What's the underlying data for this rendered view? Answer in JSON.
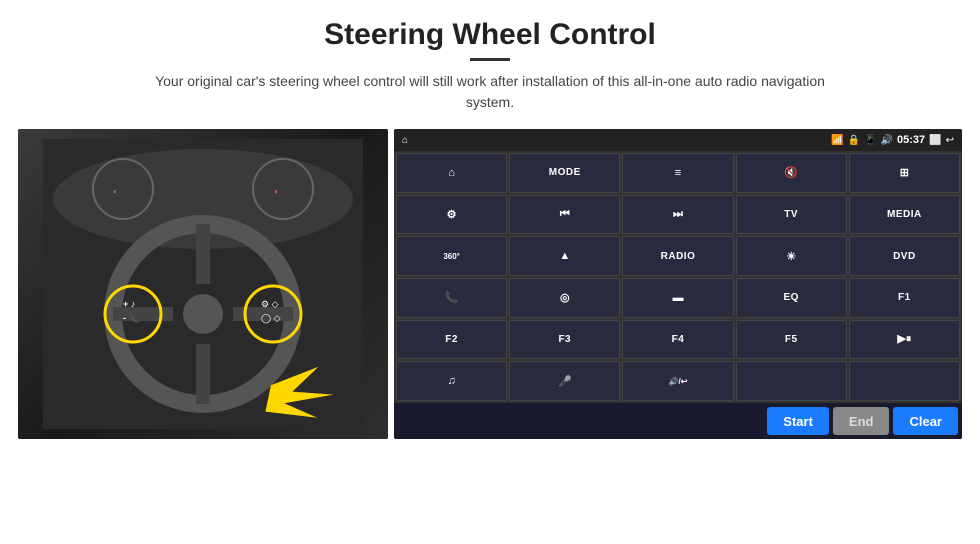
{
  "header": {
    "title": "Steering Wheel Control",
    "subtitle": "Your original car's steering wheel control will still work after installation of this all-in-one auto radio navigation system."
  },
  "status_bar": {
    "time": "05:37",
    "icons": [
      "wifi",
      "lock",
      "sim",
      "bluetooth",
      "back"
    ]
  },
  "grid_buttons": [
    {
      "id": "home",
      "icon": "⌂",
      "type": "icon"
    },
    {
      "id": "mode",
      "label": "MODE",
      "type": "text"
    },
    {
      "id": "menu",
      "icon": "≡",
      "type": "icon"
    },
    {
      "id": "mute",
      "icon": "🔇",
      "type": "icon"
    },
    {
      "id": "apps",
      "icon": "⊞",
      "type": "icon"
    },
    {
      "id": "settings",
      "icon": "⚙",
      "type": "icon"
    },
    {
      "id": "prev",
      "icon": "◀◀",
      "type": "icon"
    },
    {
      "id": "next",
      "icon": "▶▶",
      "type": "icon"
    },
    {
      "id": "tv",
      "label": "TV",
      "type": "text"
    },
    {
      "id": "media",
      "label": "MEDIA",
      "type": "text"
    },
    {
      "id": "cam360",
      "icon": "360°",
      "type": "icon"
    },
    {
      "id": "eject",
      "icon": "▲",
      "type": "icon"
    },
    {
      "id": "radio",
      "label": "RADIO",
      "type": "text"
    },
    {
      "id": "brightness",
      "icon": "☀",
      "type": "icon"
    },
    {
      "id": "dvd",
      "label": "DVD",
      "type": "text"
    },
    {
      "id": "phone",
      "icon": "📞",
      "type": "icon"
    },
    {
      "id": "nav",
      "icon": "◎",
      "type": "icon"
    },
    {
      "id": "screen",
      "icon": "▬",
      "type": "icon"
    },
    {
      "id": "eq",
      "label": "EQ",
      "type": "text"
    },
    {
      "id": "f1",
      "label": "F1",
      "type": "text"
    },
    {
      "id": "f2",
      "label": "F2",
      "type": "text"
    },
    {
      "id": "f3",
      "label": "F3",
      "type": "text"
    },
    {
      "id": "f4",
      "label": "F4",
      "type": "text"
    },
    {
      "id": "f5",
      "label": "F5",
      "type": "text"
    },
    {
      "id": "playpause",
      "icon": "▶⏸",
      "type": "icon"
    },
    {
      "id": "music",
      "icon": "♫",
      "type": "icon"
    },
    {
      "id": "mic",
      "icon": "🎤",
      "type": "icon"
    },
    {
      "id": "vol",
      "icon": "🔊/↩",
      "type": "icon"
    },
    {
      "id": "empty1",
      "label": "",
      "type": "empty"
    },
    {
      "id": "empty2",
      "label": "",
      "type": "empty"
    }
  ],
  "bottom_buttons": {
    "start": "Start",
    "end": "End",
    "clear": "Clear"
  }
}
